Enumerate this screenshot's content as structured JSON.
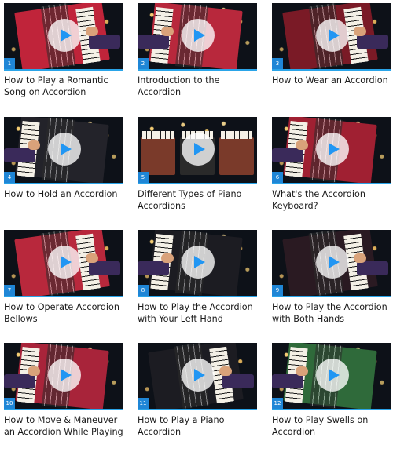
{
  "colors": {
    "accent": "#2aa4e8",
    "badge": "#1f86d6",
    "play_icon": "#2196f3",
    "title_text": "#1a1a1a"
  },
  "play_icon_name": "play-icon",
  "videos": [
    {
      "number": "1",
      "title": "How to Play a Romantic Song on Accordion",
      "accordion_color": "#c0243a",
      "thumbnail_theme": "red"
    },
    {
      "number": "2",
      "title": "Introduction to the Accordion",
      "accordion_color": "#b8283c",
      "thumbnail_theme": "red"
    },
    {
      "number": "3",
      "title": "How to Wear an Accordion",
      "accordion_color": "#7a1a26",
      "thumbnail_theme": "dark-red"
    },
    {
      "number": "4",
      "title": "How to Hold an Accordion",
      "accordion_color": "#23232a",
      "thumbnail_theme": "black"
    },
    {
      "number": "5",
      "title": "Different Types of Piano Accordions",
      "accordion_color": "#7a3a2a",
      "thumbnail_theme": "row"
    },
    {
      "number": "6",
      "title": "What's the Accordion Keyboard?",
      "accordion_color": "#a02032",
      "thumbnail_theme": "red"
    },
    {
      "number": "7",
      "title": "How to Operate Accordion Bellows",
      "accordion_color": "#b8283c",
      "thumbnail_theme": "red"
    },
    {
      "number": "8",
      "title": "How to Play the Accordion with Your Left Hand",
      "accordion_color": "#1c1c22",
      "thumbnail_theme": "black"
    },
    {
      "number": "9",
      "title": "How to Play the Accordion with Both Hands",
      "accordion_color": "#2a1a22",
      "thumbnail_theme": "black"
    },
    {
      "number": "10",
      "title": "How to Move & Maneuver an Accordion While Playing",
      "accordion_color": "#a8243a",
      "thumbnail_theme": "red"
    },
    {
      "number": "11",
      "title": "How to Play a Piano Accordion",
      "accordion_color": "#1c1c22",
      "thumbnail_theme": "black"
    },
    {
      "number": "12",
      "title": "How to Play Swells on Accordion",
      "accordion_color": "#2f6a3a",
      "thumbnail_theme": "green"
    }
  ]
}
